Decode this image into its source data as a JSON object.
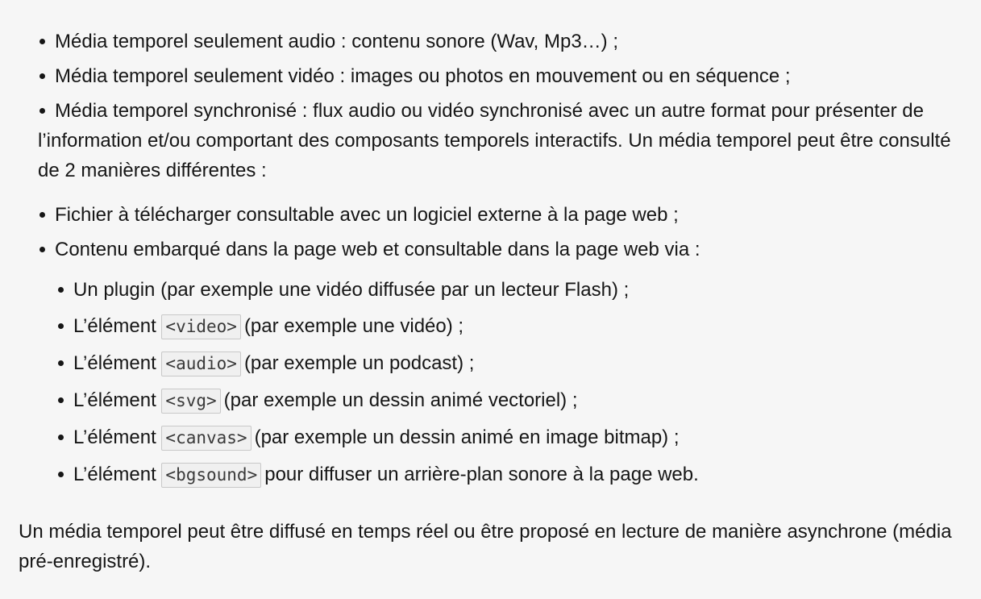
{
  "list_a": [
    "Média temporel seulement audio : contenu sonore (Wav, Mp3…) ;",
    "Média temporel seulement vidéo : images ou photos en mouvement ou en séquence ;"
  ],
  "list_a_item3": "Média temporel synchronisé : flux audio ou vidéo synchronisé avec un autre format pour présenter de l’information et/ou comportant des composants temporels interactifs. Un média temporel peut être consulté de 2 manières différentes :",
  "list_b": [
    "Fichier à télécharger consultable avec un logiciel externe à la page web ;",
    "Contenu embarqué dans la page web et consultable dans la page web via :"
  ],
  "sublist": {
    "plugin": "Un plugin (par exemple une vidéo diffusée par un lecteur Flash) ;",
    "items": [
      {
        "prefix": "L’élément",
        "code": "<video>",
        "suffix": "(par exemple une vidéo) ;"
      },
      {
        "prefix": "L’élément",
        "code": "<audio>",
        "suffix": "(par exemple un podcast) ;"
      },
      {
        "prefix": "L’élément",
        "code": "<svg>",
        "suffix": "(par exemple un dessin animé vectoriel) ;"
      },
      {
        "prefix": "L’élément",
        "code": "<canvas>",
        "suffix": "(par exemple un dessin animé en image bitmap) ;"
      },
      {
        "prefix": "L’élément",
        "code": "<bgsound>",
        "suffix": "pour diffuser un arrière-plan sonore à la page web."
      }
    ]
  },
  "closing_paragraph": "Un média temporel peut être diffusé en temps réel ou être proposé en lecture de manière asynchrone (média pré-enregistré)."
}
